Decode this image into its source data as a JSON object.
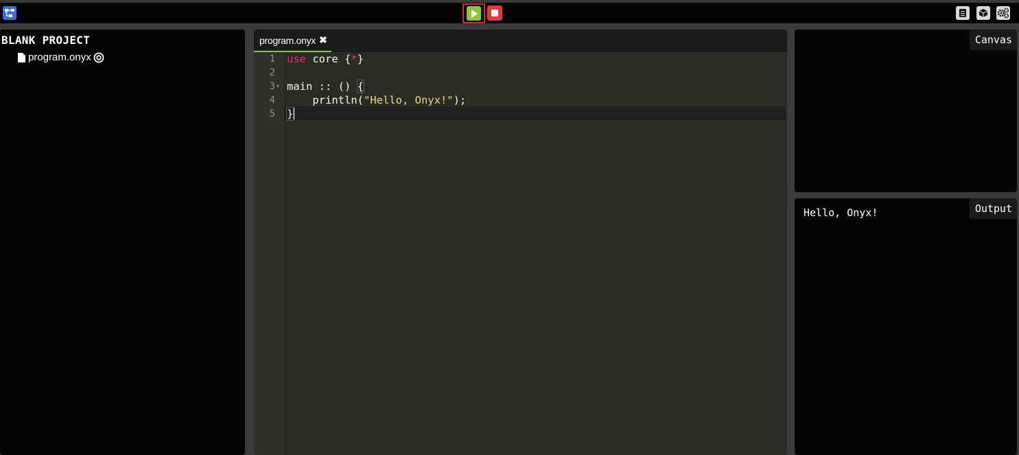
{
  "toolbar": {
    "icons": [
      "project-tree-icon",
      "run-icon",
      "stop-icon",
      "docs-icon",
      "package-icon",
      "settings-icon"
    ]
  },
  "explorer": {
    "project_title": "BLANK PROJECT",
    "files": [
      {
        "name": "program.onyx",
        "icon": "file-icon",
        "marker_icon": "target-icon"
      }
    ]
  },
  "editor": {
    "tab_label": "program.onyx",
    "close_glyph": "✖",
    "line_numbers": [
      "1",
      "2",
      "3",
      "4",
      "5"
    ],
    "fold_glyph": "▾",
    "code": {
      "line1_kw": "use",
      "line1_rest": " core {",
      "line1_star": "*",
      "line1_end": "}",
      "line3": "main :: () ",
      "line3_brace": "{",
      "line4_pre": "    println(",
      "line4_str": "\"Hello, Onyx!\"",
      "line4_post": ");",
      "line5": "}"
    }
  },
  "canvas_panel": {
    "label": "Canvas"
  },
  "output_panel": {
    "label": "Output",
    "text": "Hello, Onyx!"
  },
  "colors": {
    "run": "#8cc63f",
    "stop": "#e03a3e",
    "tree": "#3f6fd6",
    "keyword": "#f92672",
    "string": "#e6db74"
  }
}
